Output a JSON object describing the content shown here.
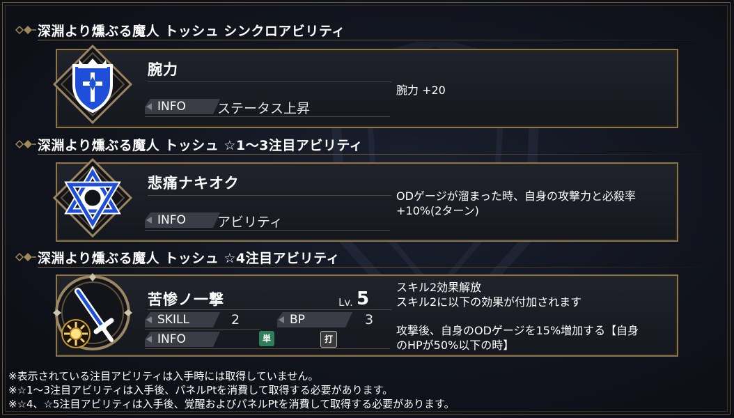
{
  "sections": [
    {
      "title": "深淵より燻ぶる魔人 トッシュ シンクロアビリティ",
      "icon": "shield-crest-icon",
      "name": "腕力",
      "info_label": "INFO",
      "info_value": "ステータス上昇",
      "description": "腕力 +20"
    },
    {
      "title": "深淵より燻ぶる魔人 トッシュ ☆1〜3注目アビリティ",
      "icon": "triquetra-knot-icon",
      "name": "悲痛ナキオク",
      "info_label": "INFO",
      "info_value": "アビリティ",
      "description": "ODゲージが溜まった時、自身の攻撃力と必殺率\n+10%(2ターン)"
    },
    {
      "title": "深淵より燻ぶる魔人 トッシュ ☆4注目アビリティ",
      "icon": "sword-skill-icon",
      "name": "苦惨ノ一撃",
      "level_label": "Lv.",
      "level_value": "5",
      "skill_label": "SKILL",
      "skill_value": "2",
      "bp_label": "BP",
      "bp_value": "3",
      "info_label": "INFO",
      "target_badge": "単",
      "attack_badge": "打",
      "description_head": "スキル2効果解放\nスキル2に以下の効果が付加されます",
      "description_body": "攻撃後、自身のODゲージを15%増加する【自身\nのHPが50%以下の時】"
    }
  ],
  "notes": [
    "※表示されている注目アビリティは入手時には取得していません。",
    "※☆1〜3注目アビリティは入手後、パネルPtを消費して取得する必要があります。",
    "※☆4、☆5注目アビリティは入手後、覚醒およびパネルPtを消費して取得する必要があります。"
  ],
  "colors": {
    "accent_gold": "#8a7650",
    "icon_blue": "#1f4fd8",
    "pill_bg": "#3a3d45",
    "badge_target": "#2f7d5a",
    "badge_attack": "#3a3a3a"
  }
}
